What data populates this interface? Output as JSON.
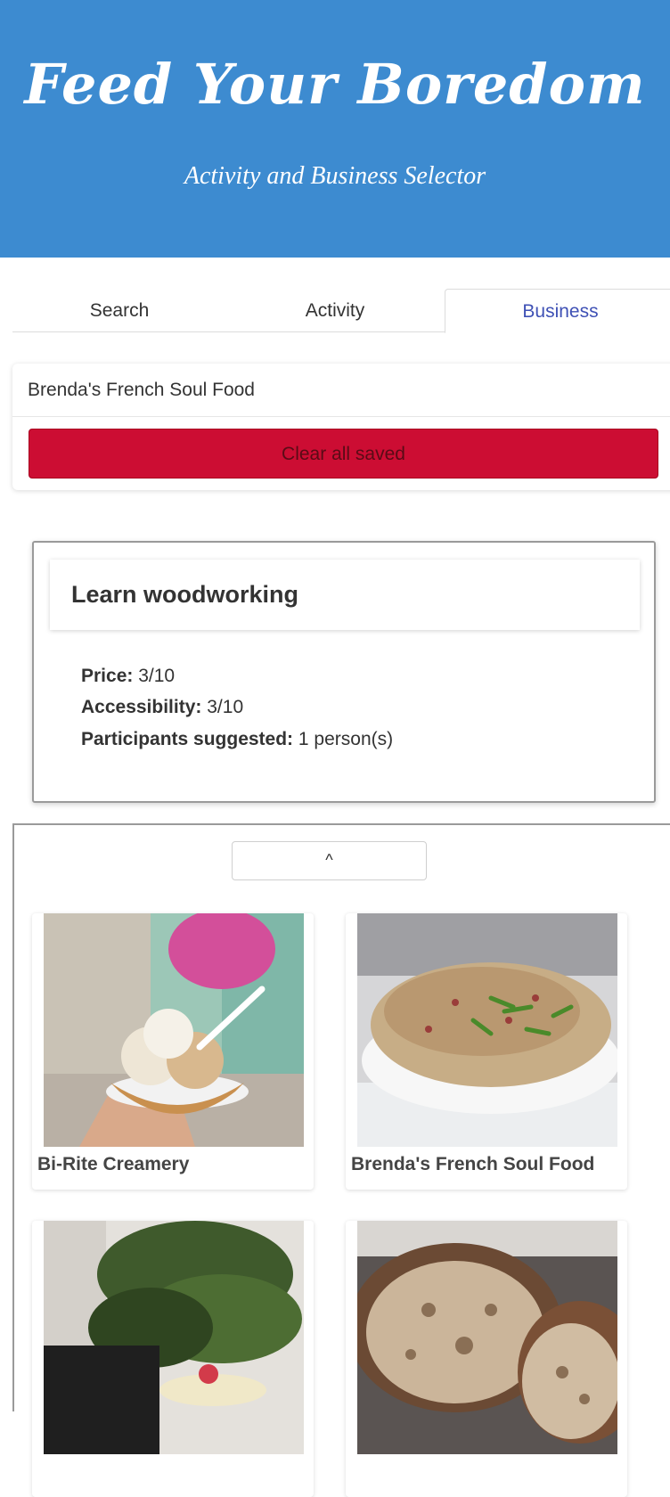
{
  "header": {
    "title": "Feed Your Boredom",
    "subtitle": "Activity and Business Selector"
  },
  "tabs": [
    {
      "label": "Search",
      "active": false
    },
    {
      "label": "Activity",
      "active": false
    },
    {
      "label": "Business",
      "active": true
    }
  ],
  "saved": {
    "items": [
      "Brenda's French Soul Food"
    ],
    "clear_label": "Clear all saved"
  },
  "activity": {
    "title": "Learn woodworking",
    "price_label": "Price:",
    "price_value": "3/10",
    "accessibility_label": "Accessibility:",
    "accessibility_value": "3/10",
    "participants_label": "Participants suggested:",
    "participants_value": "1 person(s)"
  },
  "businesses": {
    "collapse_label": "^",
    "items": [
      {
        "name": "Bi-Rite Creamery",
        "image": "ice-cream-photo"
      },
      {
        "name": "Brenda's French Soul Food",
        "image": "dish-photo"
      },
      {
        "name": "",
        "image": "dessert-photo"
      },
      {
        "name": "",
        "image": "bread-photo"
      }
    ]
  },
  "colors": {
    "header_bg": "#3d8bd0",
    "active_tab": "#3f51b5",
    "clear_button": "#cc0d33"
  }
}
